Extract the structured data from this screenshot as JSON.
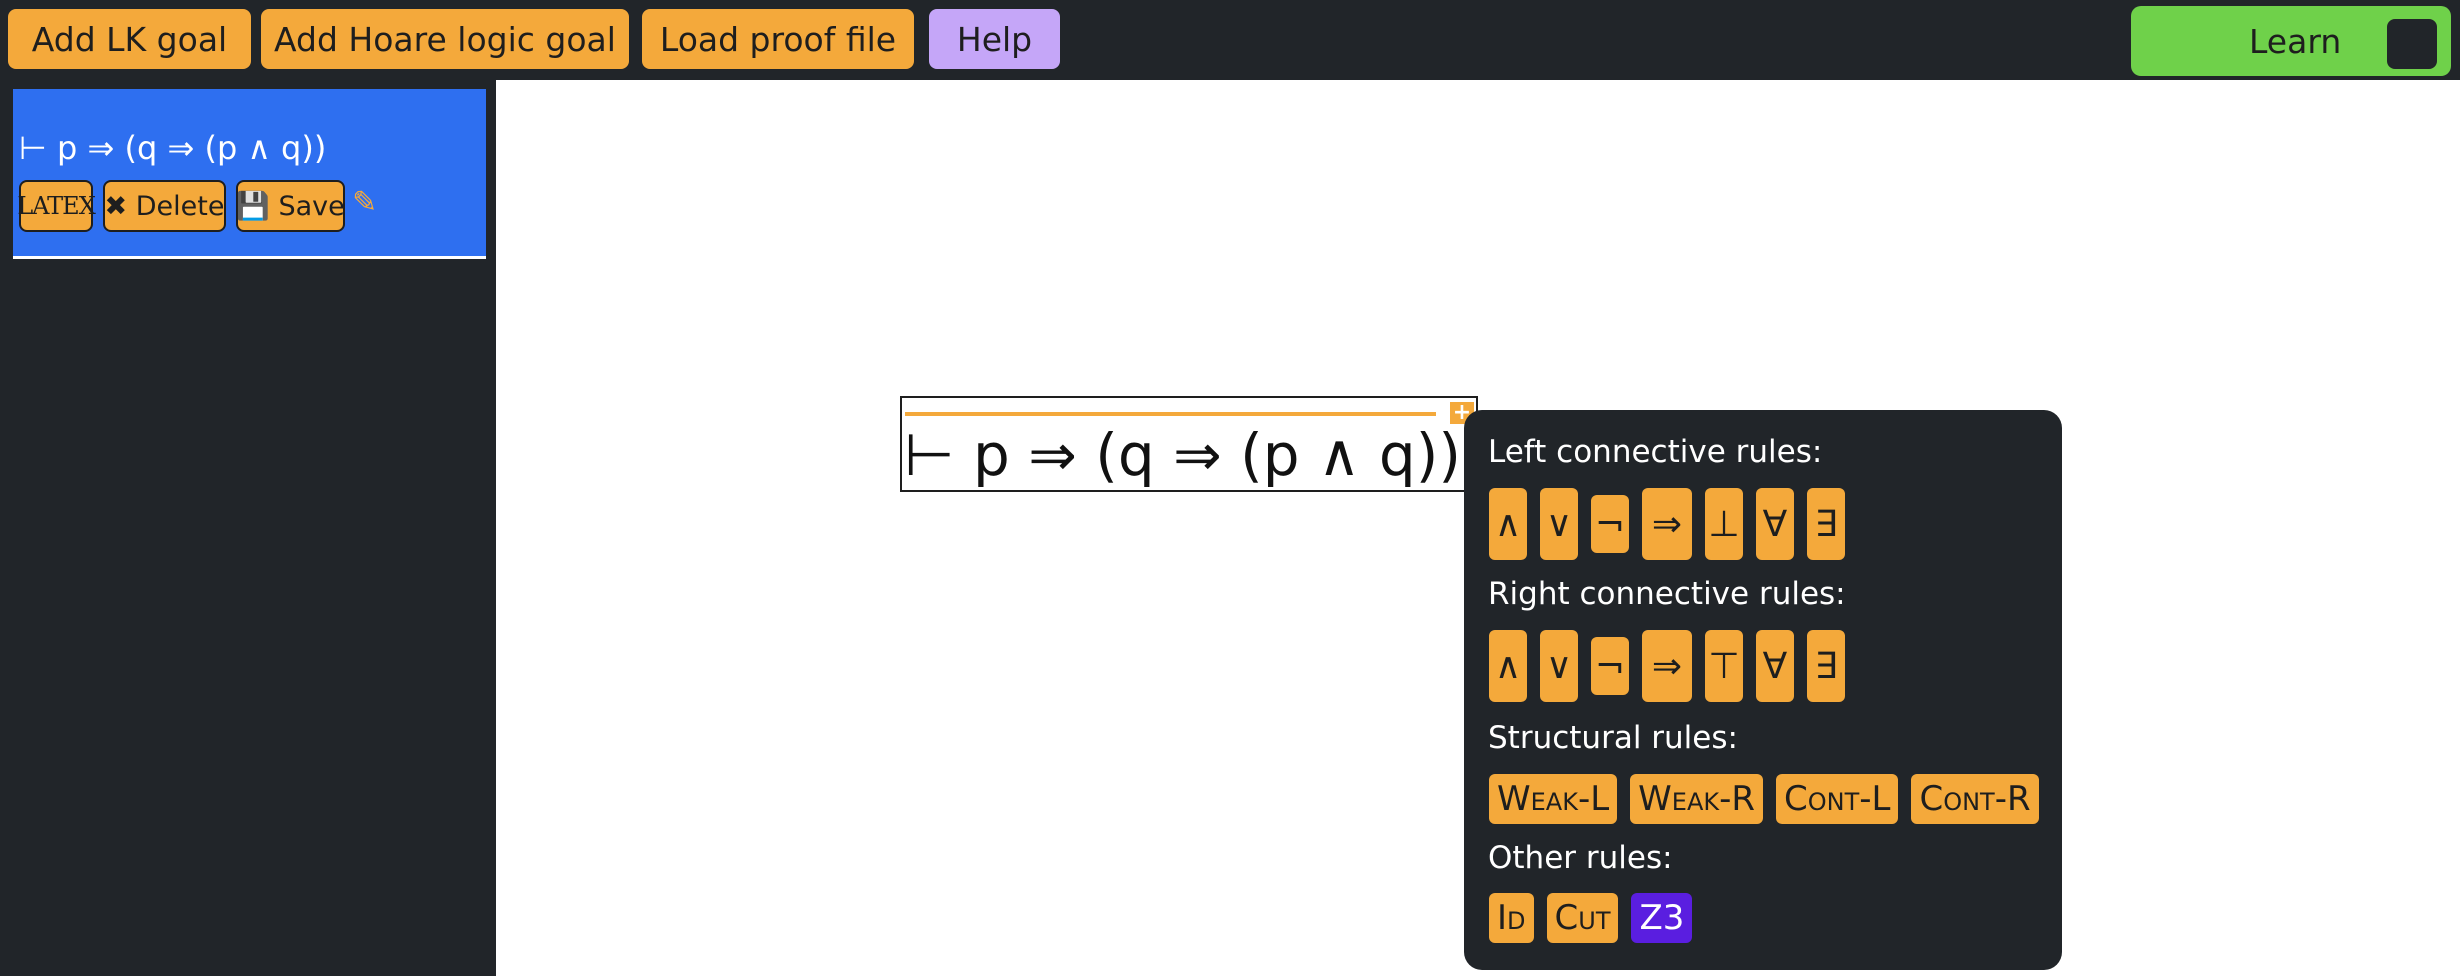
{
  "toolbar": {
    "add_lk_goal": "Add LK goal",
    "add_hoare_goal": "Add Hoare logic goal",
    "load_proof_file": "Load proof file",
    "help": "Help",
    "learn": "Learn"
  },
  "sidebar": {
    "goal": {
      "formula": "⊢ p ⇒ (q ⇒ (p ∧ q))",
      "latex_label": "LATEX",
      "delete_label": "✖ Delete",
      "save_label": "💾 Save",
      "edit_icon": "✎"
    }
  },
  "canvas": {
    "sequent": "⊢ p ⇒ (q ⇒ (p ∧ q))",
    "plus": "+"
  },
  "rules_panel": {
    "left_title": "Left connective rules:",
    "left_rules": [
      "∧",
      "∨",
      "¬",
      "⇒",
      "⊥",
      "∀",
      "∃"
    ],
    "right_title": "Right connective rules:",
    "right_rules": [
      "∧",
      "∨",
      "¬",
      "⇒",
      "⊤",
      "∀",
      "∃"
    ],
    "structural_title": "Structural rules:",
    "structural_rules": [
      "Weak-L",
      "Weak-R",
      "Cont-L",
      "Cont-R"
    ],
    "other_title": "Other rules:",
    "other_rules": [
      "Id",
      "Cut",
      "Z3"
    ]
  },
  "colors": {
    "accent": "#f4a93b",
    "help": "#c5a6f8",
    "learn": "#6fd14a",
    "goal_card": "#2e6ff0",
    "z3": "#5a1ee0",
    "dark": "#212529"
  }
}
